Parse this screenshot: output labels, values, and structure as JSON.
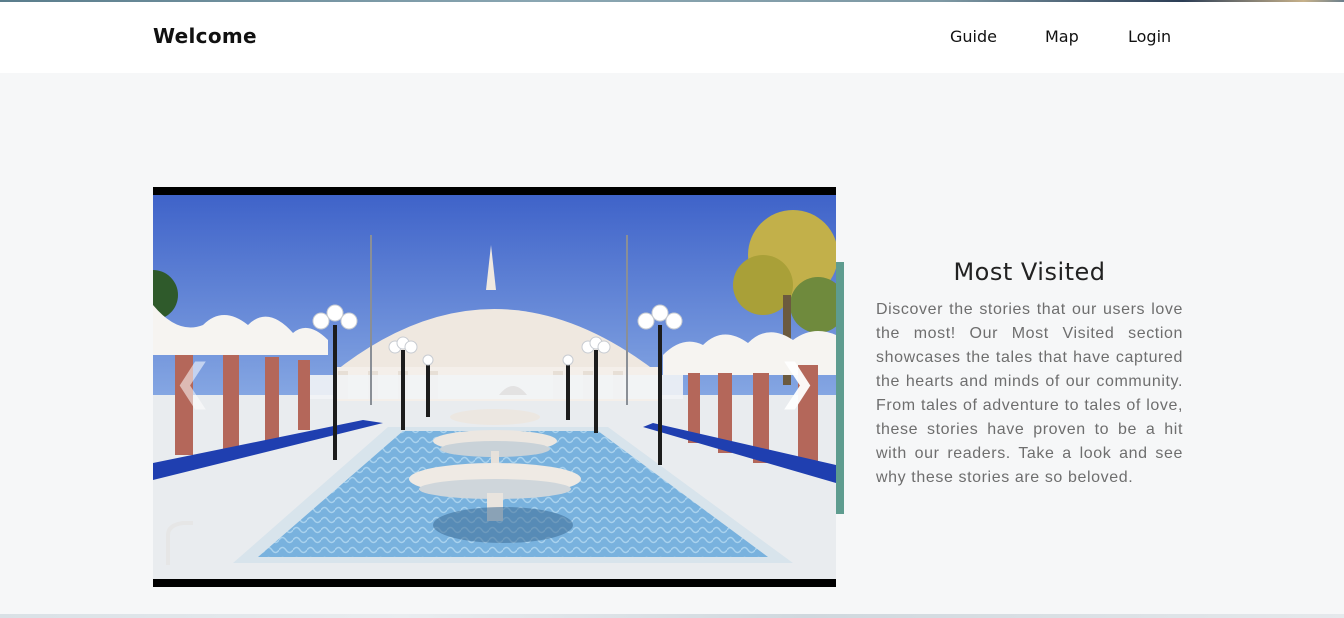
{
  "navbar": {
    "brand": "Welcome",
    "links": [
      {
        "label": "Guide"
      },
      {
        "label": "Map"
      },
      {
        "label": "Login"
      }
    ]
  },
  "carousel": {
    "prev_label": "❮",
    "next_label": "❯",
    "slide_alt": "Mausoleum with fountains"
  },
  "most_visited": {
    "title": "Most Visited",
    "description": "Discover the stories that our users love the most! Our Most Visited section showcases the tales that have captured the hearts and minds of our community. From tales of adventure to tales of love, these stories have proven to be a hit with our readers. Take a look and see why these stories are so beloved."
  },
  "colors": {
    "accent_bar": "#5e9c8f",
    "page_background": "#f6f7f8",
    "navbar_background": "#ffffff"
  }
}
